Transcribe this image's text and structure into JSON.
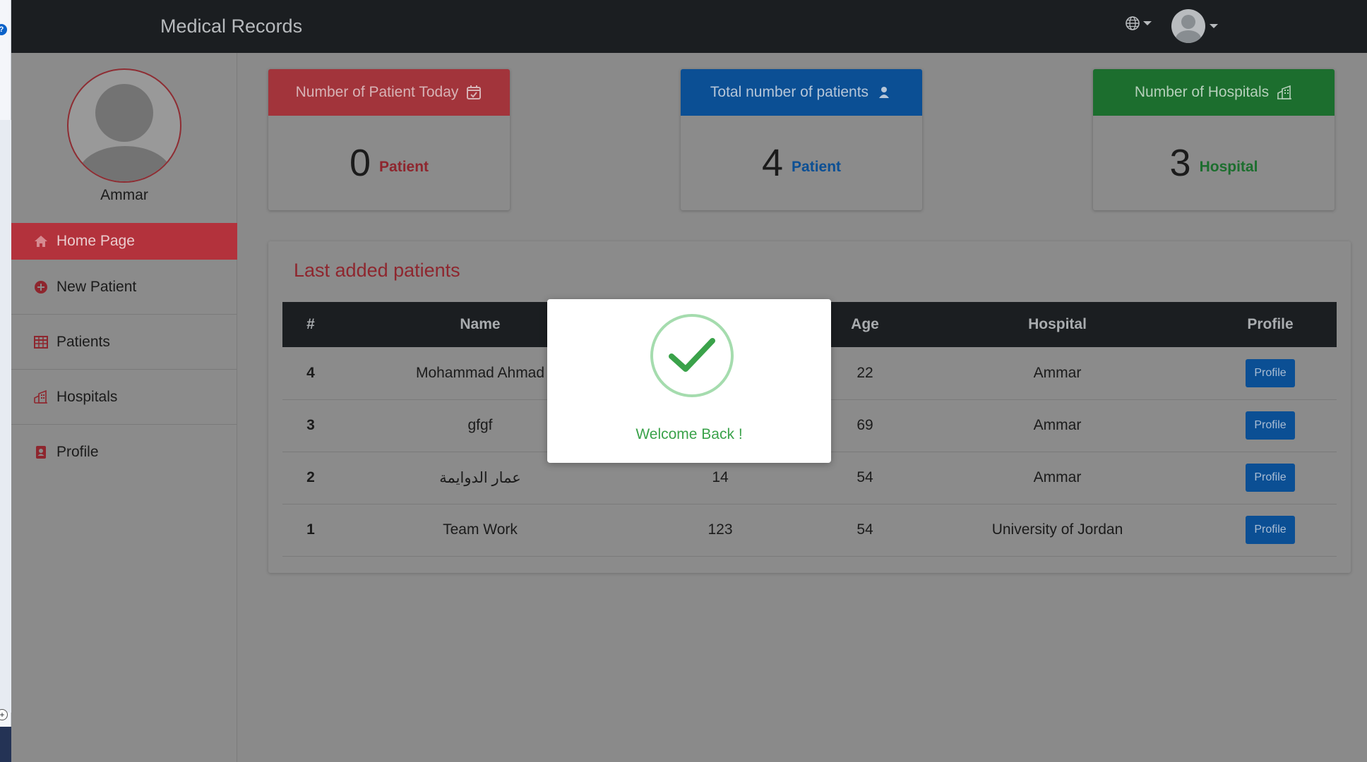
{
  "app": {
    "title": "Medical Records"
  },
  "header": {
    "language_icon": "globe-icon",
    "user_icon": "user-avatar-icon"
  },
  "sidebar": {
    "username": "Ammar",
    "items": [
      {
        "label": "Home Page",
        "icon": "home-icon",
        "active": true
      },
      {
        "label": "New Patient",
        "icon": "plus-circle-icon"
      },
      {
        "label": "Patients",
        "icon": "table-icon"
      },
      {
        "label": "Hospitals",
        "icon": "building-icon"
      },
      {
        "label": "Profile",
        "icon": "id-card-icon"
      }
    ]
  },
  "cards": [
    {
      "title": "Number of Patient Today",
      "value": "0",
      "unit": "Patient",
      "color": "#b3323c",
      "icon": "calendar-check-icon"
    },
    {
      "title": "Total number of patients",
      "value": "4",
      "unit": "Patient",
      "color": "#0b4f94",
      "icon": "user-icon"
    },
    {
      "title": "Number of Hospitals",
      "value": "3",
      "unit": "Hospital",
      "color": "#1c6e2e",
      "icon": "building-icon"
    }
  ],
  "panel": {
    "title": "Last added patients",
    "columns": [
      "#",
      "Name",
      "",
      "Age",
      "Hospital",
      "Profile"
    ],
    "rows": [
      {
        "id": "4",
        "name": "Mohammad Ahmad",
        "col3": "",
        "age": "22",
        "hospital": "Ammar",
        "button": "Profile"
      },
      {
        "id": "3",
        "name": "gfgf",
        "col3": "",
        "age": "69",
        "hospital": "Ammar",
        "button": "Profile"
      },
      {
        "id": "2",
        "name": "عمار الدوايمة",
        "col3": "14",
        "age": "54",
        "hospital": "Ammar",
        "button": "Profile"
      },
      {
        "id": "1",
        "name": "Team Work",
        "col3": "123",
        "age": "54",
        "hospital": "University of Jordan",
        "button": "Profile"
      }
    ]
  },
  "modal": {
    "message": "Welcome Back !",
    "icon": "checkmark-icon"
  },
  "colors": {
    "accent_red": "#b3323c",
    "accent_blue": "#0b4f94",
    "accent_green": "#1c6e2e",
    "success": "#3aa24a"
  }
}
